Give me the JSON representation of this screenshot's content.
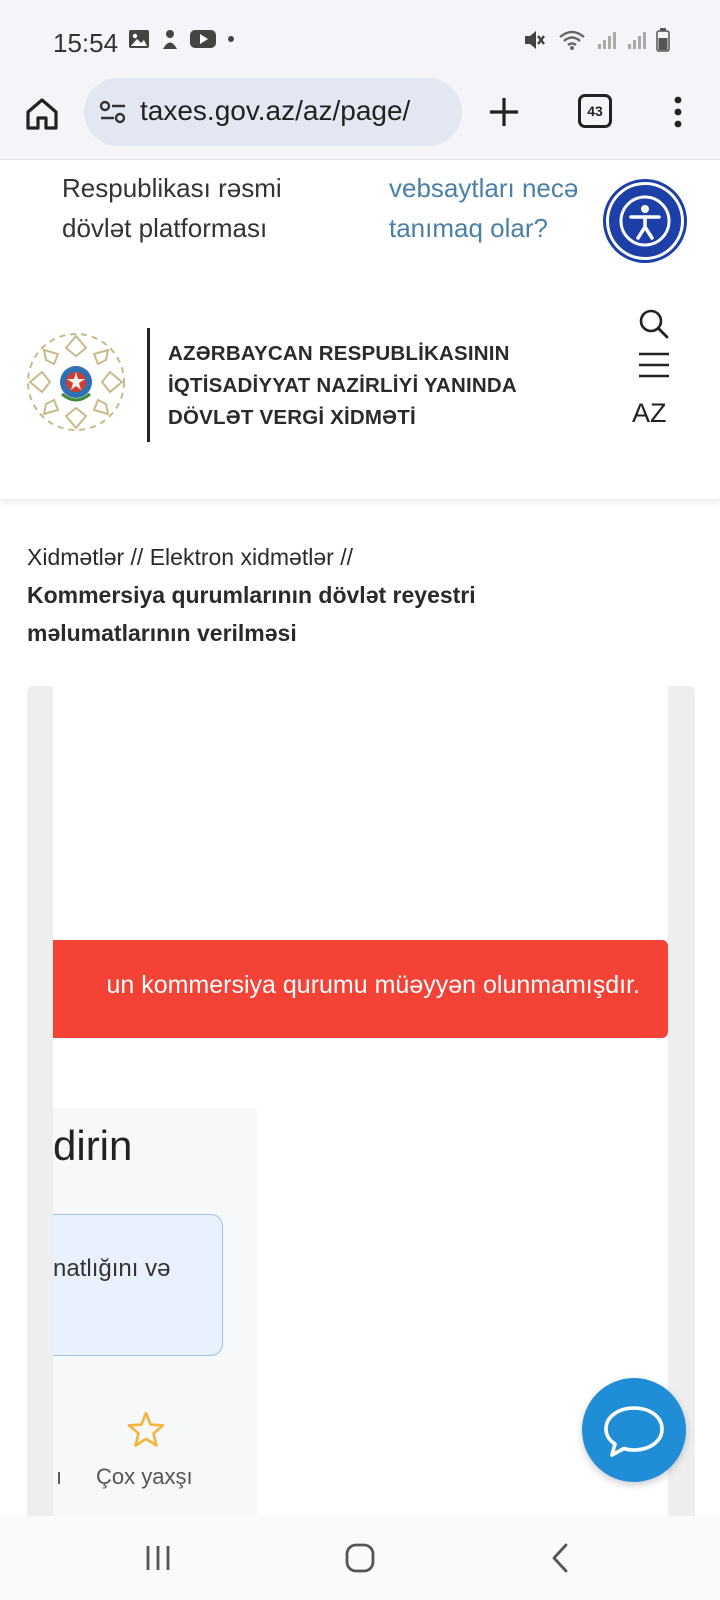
{
  "status_bar": {
    "time": "15:54"
  },
  "browser": {
    "url": "taxes.gov.az/az/page/",
    "tab_count": "43"
  },
  "top_strip": {
    "gov_line1": "Respublikası rəsmi",
    "gov_line2": "dövlət platforması",
    "recognize_line1": "vebsaytları necə",
    "recognize_line2": "tanımaq olar?"
  },
  "header": {
    "org_line1": "AZƏRBAYCAN RESPUBLİKASININ",
    "org_line2": "İQTİSADİYYAT NAZİRLİYİ YANINDA",
    "org_line3": "DÖVLƏT VERGİ XİDMƏTİ",
    "language": "AZ"
  },
  "breadcrumb": {
    "item1": "Xidmətlər",
    "separator": "//",
    "item2": "Elektron xidmətlər",
    "current": "Kommersiya qurumlarının dövlət reyestri məlumatlarının verilməsi"
  },
  "content": {
    "alert_text": "un kommersiya qurumu müəyyən olunmamışdır.",
    "rating_title": "dirin",
    "comment_text": "natlığını və",
    "rating_partial_label": "ı",
    "rating_label": "Çox yaxşı"
  },
  "colors": {
    "alert": "#f44336",
    "chat": "#1f8ed6",
    "accessibility": "#1d3fa8",
    "link": "#4a7fa8",
    "star": "#f2b63a"
  }
}
